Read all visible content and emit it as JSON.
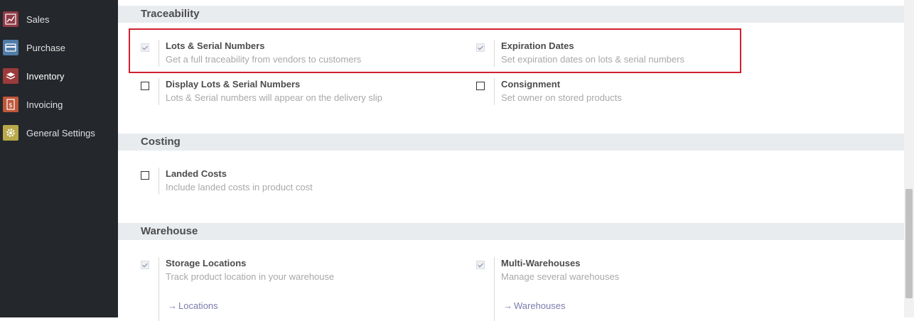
{
  "sidebar": {
    "items": [
      {
        "label": "Sales",
        "icon": "sales-chart-icon",
        "color": "#8f3b47"
      },
      {
        "label": "Purchase",
        "icon": "purchase-card-icon",
        "color": "#4f7ca8"
      },
      {
        "label": "Inventory",
        "icon": "inventory-boxes-icon",
        "color": "#9b3b3b",
        "active": true
      },
      {
        "label": "Invoicing",
        "icon": "invoice-dollar-icon",
        "color": "#c0573a"
      },
      {
        "label": "General Settings",
        "icon": "gear-icon",
        "color": "#b8a94a"
      }
    ]
  },
  "sections": {
    "traceability": {
      "title": "Traceability",
      "lots": {
        "title": "Lots & Serial Numbers",
        "desc": "Get a full traceability from vendors to customers",
        "checked": true
      },
      "expiration": {
        "title": "Expiration Dates",
        "desc": "Set expiration dates on lots & serial numbers",
        "checked": true
      },
      "display_lots": {
        "title": "Display Lots & Serial Numbers",
        "desc": "Lots & Serial numbers will appear on the delivery slip",
        "checked": false
      },
      "consignment": {
        "title": "Consignment",
        "desc": "Set owner on stored products",
        "checked": false
      }
    },
    "costing": {
      "title": "Costing",
      "landed": {
        "title": "Landed Costs",
        "desc": "Include landed costs in product cost",
        "checked": false
      }
    },
    "warehouse": {
      "title": "Warehouse",
      "storage": {
        "title": "Storage Locations",
        "desc": "Track product location in your warehouse",
        "checked": true,
        "link": "Locations"
      },
      "multi": {
        "title": "Multi-Warehouses",
        "desc": "Manage several warehouses",
        "checked": true,
        "link": "Warehouses"
      }
    }
  },
  "colors": {
    "highlight": "#d0202e",
    "sidebar_bg": "#24272b",
    "link": "#7c7bad"
  }
}
